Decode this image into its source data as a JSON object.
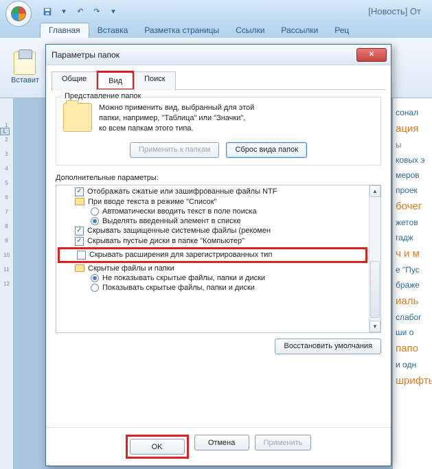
{
  "word": {
    "title": "[Новость] От",
    "ribbon_tabs": [
      "Главная",
      "Вставка",
      "Разметка страницы",
      "Ссылки",
      "Рассылки",
      "Рец"
    ],
    "paste_label": "Вставит",
    "ruler_marks": [
      "1",
      "2",
      "3",
      "4",
      "5",
      "6",
      "7",
      "8",
      "9",
      "10",
      "11",
      "12"
    ]
  },
  "side": {
    "items": [
      "сонал",
      "ация",
      "ы",
      "ковых э",
      "меров",
      "проек",
      "бочег",
      "жетов",
      "гадж",
      "ч и м",
      "е \"Пус",
      "браже",
      "иаль",
      "слабог",
      "ши о",
      "папо",
      "и одн"
    ],
    "footer": "шрифты"
  },
  "dialog": {
    "title": "Параметры папок",
    "tabs": {
      "general": "Общие",
      "view": "Вид",
      "search": "Поиск"
    },
    "group1": {
      "title": "Представление папок",
      "desc1": "Можно применить вид, выбранный для этой",
      "desc2": "папки, например, \"Таблица\" или \"Значки\",",
      "desc3": "ко всем папкам этого типа.",
      "apply_btn": "Применить к папкам",
      "reset_btn": "Сброс вида папок"
    },
    "adv_label": "Дополнительные параметры:",
    "list": {
      "r0": "Отображать сжатые или зашифрованные файлы NTF",
      "r1": "При вводе текста в режиме \"Список\"",
      "r2": "Автоматически вводить текст в поле поиска",
      "r3": "Выделять введенный элемент в списке",
      "r4": "Скрывать защищенные системные файлы (рекомен",
      "r5": "Скрывать пустые диски в папке \"Компьютер\"",
      "r6": "Скрывать расширения для зарегистрированных тип",
      "r7": "Скрытые файлы и папки",
      "r8": "Не показывать скрытые файлы, папки и диски",
      "r9": "Показывать скрытые файлы, папки и диски"
    },
    "restore_btn": "Восстановить умолчания",
    "ok": "OK",
    "cancel": "Отмена",
    "apply": "Применить"
  }
}
